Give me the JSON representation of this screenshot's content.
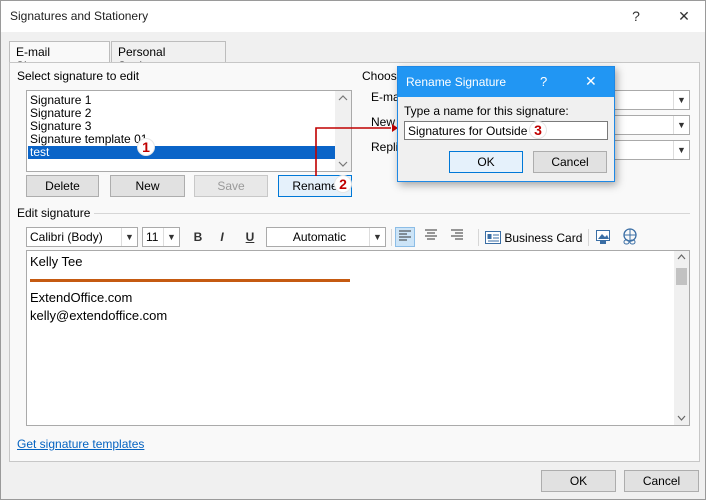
{
  "window": {
    "title": "Signatures and Stationery",
    "help_glyph": "?",
    "close_glyph": "✕"
  },
  "tabs": [
    {
      "label": "E-mail Signature",
      "active": true
    },
    {
      "label": "Personal Stationery",
      "active": false
    }
  ],
  "select_section": {
    "label": "Select signature to edit",
    "items": [
      {
        "label": "Signature 1",
        "selected": false
      },
      {
        "label": "Signature 2",
        "selected": false
      },
      {
        "label": "Signature 3",
        "selected": false
      },
      {
        "label": "Signature template 01",
        "selected": false
      },
      {
        "label": "test",
        "selected": true
      }
    ],
    "buttons": {
      "delete": "Delete",
      "new": "New",
      "save": "Save",
      "rename": "Rename"
    }
  },
  "choose_section": {
    "label": "Choose",
    "rows": [
      {
        "label": "E-mai",
        "value": ""
      },
      {
        "label": "New",
        "value": ""
      },
      {
        "label": "Repli",
        "value": ""
      }
    ]
  },
  "edit_section": {
    "label": "Edit signature",
    "font_name": "Calibri (Body)",
    "font_size": "11",
    "bold": "B",
    "italic": "I",
    "underline": "U",
    "color": "Automatic",
    "business_card": "Business Card",
    "content": {
      "name": "Kelly Tee",
      "site": "ExtendOffice.com",
      "email": "kelly@extendoffice.com",
      "divider_color": "#c55a11"
    }
  },
  "footer": {
    "templates_link": "Get signature templates",
    "ok": "OK",
    "cancel": "Cancel"
  },
  "rename_dialog": {
    "title": "Rename Signature",
    "help_glyph": "?",
    "close_glyph": "✕",
    "prompt": "Type a name for this signature:",
    "value": "Signatures for Outside",
    "ok": "OK",
    "cancel": "Cancel"
  },
  "annotations": {
    "step1": "1",
    "step2": "2",
    "step3": "3",
    "color": "#c00000"
  },
  "colors": {
    "accent": "#0078d7",
    "dialog_title": "#2196f3",
    "selection": "#0a64c8",
    "link": "#0563c1"
  }
}
